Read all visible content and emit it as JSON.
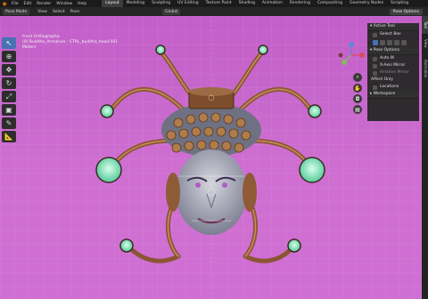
{
  "topbar": {
    "menus": [
      "File",
      "Edit",
      "Render",
      "Window",
      "Help"
    ],
    "workspaces": [
      "Layout",
      "Modeling",
      "Sculpting",
      "UV Editing",
      "Texture Paint",
      "Shading",
      "Animation",
      "Rendering",
      "Compositing",
      "Geometry Nodes",
      "Scripting"
    ],
    "active_workspace": "Layout"
  },
  "header": {
    "mode": "Pose Mode",
    "menus": [
      "View",
      "Select",
      "Pose"
    ],
    "orientation": "Global",
    "pose_options": "Pose Options"
  },
  "viewport": {
    "info_line1": "Front Orthographic",
    "info_line2": "(0) Buddha_Armature : CTRL_buddha_head.001",
    "info_line3": "Meters"
  },
  "npanel": {
    "active_tool_title": "Active Tool",
    "select_box": "Select Box",
    "pose_options_title": "Pose Options",
    "auto_ik": "Auto IK",
    "x_axis_mirror": "X-Axis Mirror",
    "relative_mirror": "Relative Mirror",
    "affect_only": "Affect Only",
    "locations": "Locations",
    "workspace": "Workspace"
  },
  "side_tabs": [
    "Tool",
    "View",
    "Animation"
  ],
  "colors": {
    "viewport_bg": "#c768cc",
    "accent": "#4772b3",
    "copper": "#a0643a",
    "jade": "#8ff0c0"
  }
}
